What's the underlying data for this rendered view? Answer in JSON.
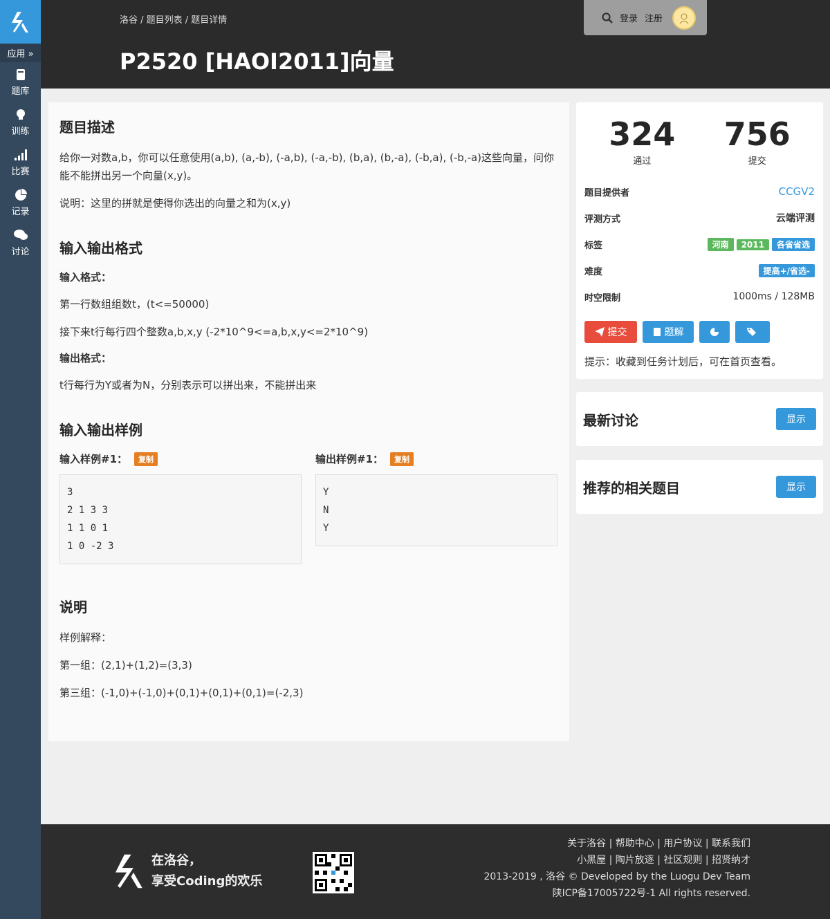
{
  "sidebar": {
    "apps_label": "应用 »",
    "items": [
      {
        "label": "题库",
        "icon": "book-icon"
      },
      {
        "label": "训练",
        "icon": "lightbulb-icon"
      },
      {
        "label": "比赛",
        "icon": "signal-icon"
      },
      {
        "label": "记录",
        "icon": "pie-chart-icon"
      },
      {
        "label": "讨论",
        "icon": "comments-icon"
      }
    ]
  },
  "header": {
    "breadcrumb": "洛谷 / 题目列表 / 题目详情",
    "title": "P2520 [HAOI2011]向量",
    "login": "登录",
    "register": "注册"
  },
  "problem": {
    "desc_title": "题目描述",
    "desc_p1": "给你一对数a,b，你可以任意使用(a,b), (a,-b), (-a,b), (-a,-b), (b,a), (b,-a), (-b,a), (-b,-a)这些向量，问你能不能拼出另一个向量(x,y)。",
    "desc_p2": "说明：这里的拼就是使得你选出的向量之和为(x,y)",
    "io_title": "输入输出格式",
    "input_format_label": "输入格式：",
    "input_line1": "第一行数组组数t，(t<=50000)",
    "input_line2": "接下来t行每行四个整数a,b,x,y (-2*10^9<=a,b,x,y<=2*10^9)",
    "output_format_label": "输出格式：",
    "output_line1": "t行每行为Y或者为N，分别表示可以拼出来，不能拼出来",
    "samples_title": "输入输出样例",
    "sample_in_label": "输入样例#1：",
    "sample_out_label": "输出样例#1：",
    "copy_label": "复制",
    "sample_in": [
      "3",
      "2 1 3 3",
      "1 1 0 1",
      "1 0 -2 3"
    ],
    "sample_out": [
      "Y",
      "N",
      "Y"
    ],
    "note_title": "说明",
    "note_p1": "样例解释：",
    "note_p2": "第一组：(2,1)+(1,2)=(3,3)",
    "note_p3": "第三组：(-1,0)+(-1,0)+(0,1)+(0,1)+(0,1)=(-2,3)"
  },
  "stats": {
    "passed": "324",
    "passed_label": "通过",
    "submitted": "756",
    "submitted_label": "提交"
  },
  "info": {
    "provider_label": "题目提供者",
    "provider": "CCGV2",
    "judge_label": "评测方式",
    "judge": "云端评测",
    "tags_label": "标签",
    "tags": [
      {
        "text": "河南",
        "color": "#5cb85c"
      },
      {
        "text": "2011",
        "color": "#5cb85c"
      },
      {
        "text": "各省省选",
        "color": "#3498db"
      }
    ],
    "difficulty_label": "难度",
    "difficulty": "提高+/省选-",
    "difficulty_color": "#3498db",
    "limit_label": "时空限制",
    "limit": "1000ms / 128MB"
  },
  "actions": {
    "submit": "提交",
    "solution": "题解",
    "submit_color": "#e74c3c",
    "blue": "#3498db"
  },
  "tip": "提示：收藏到任务计划后，可在首页查看。",
  "panels": {
    "discussion_title": "最新讨论",
    "related_title": "推荐的相关题目",
    "show_label": "显示"
  },
  "footer": {
    "slogan_line1": "在洛谷，",
    "slogan_line2": "享受Coding的欢乐",
    "links_line1": "关于洛谷 | 帮助中心 | 用户协议 | 联系我们",
    "links_line2": "小黑屋 | 陶片放逐 | 社区规则 | 招贤纳才",
    "copyright": "2013-2019 , 洛谷 © Developed by the Luogu Dev Team",
    "icp": "陕ICP备17005722号-1 All rights reserved."
  }
}
